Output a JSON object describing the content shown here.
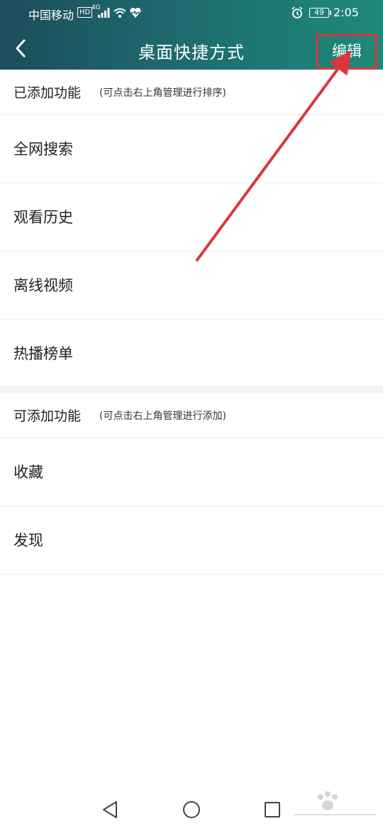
{
  "status_bar": {
    "carrier": "中国移动",
    "hd": "HD",
    "network": "4G",
    "battery": "49",
    "time": "2:05"
  },
  "nav": {
    "title": "桌面快捷方式",
    "edit_label": "编辑"
  },
  "added_section": {
    "title": "已添加功能",
    "hint": "(可点击右上角管理进行排序)",
    "items": [
      "全网搜索",
      "观看历史",
      "离线视频",
      "热播榜单"
    ]
  },
  "available_section": {
    "title": "可添加功能",
    "hint": "(可点击右上角管理进行添加)",
    "items": [
      "收藏",
      "发现"
    ]
  },
  "colors": {
    "header_start": "#1c4d5c",
    "header_end": "#1f8a7a",
    "highlight_red": "#d9363e"
  },
  "icons": [
    "back-icon",
    "alarm-icon",
    "wifi-icon",
    "signal-icon",
    "heart-icon",
    "nav-back-icon",
    "nav-home-icon",
    "nav-recent-icon"
  ]
}
